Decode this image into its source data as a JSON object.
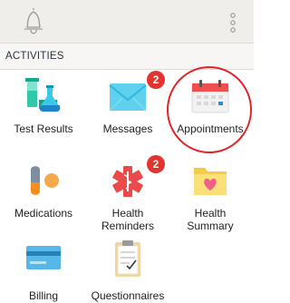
{
  "header": {
    "bell_icon": "bell-icon",
    "menu_icon": "vertical-ellipsis-icon"
  },
  "section": {
    "title": "ACTIVITIES"
  },
  "tiles": [
    {
      "label": "Test Results",
      "icon": "lab-flasks-icon"
    },
    {
      "label": "Messages",
      "icon": "envelope-icon",
      "badge": "2"
    },
    {
      "label": "Appointments",
      "icon": "calendar-icon",
      "highlighted": true
    },
    {
      "label": "Medications",
      "icon": "pill-icon"
    },
    {
      "label": "Health\nReminders",
      "icon": "medical-star-icon",
      "badge": "2"
    },
    {
      "label": "Health\nSummary",
      "icon": "heart-folder-icon"
    },
    {
      "label": "Billing",
      "icon": "credit-card-icon"
    },
    {
      "label": "Questionnaires",
      "icon": "clipboard-icon"
    }
  ],
  "colors": {
    "header_bg": "#efeeea",
    "badge": "#e2332f",
    "highlight": "#e0262a"
  }
}
